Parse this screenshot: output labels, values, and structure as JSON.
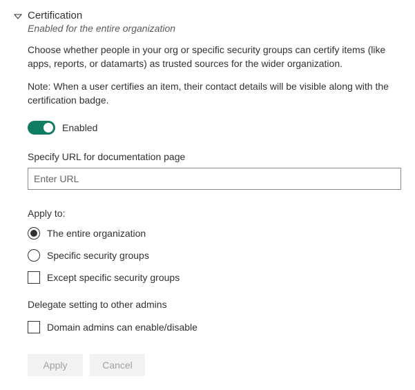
{
  "header": {
    "title": "Certification",
    "subtitle": "Enabled for the entire organization"
  },
  "description": "Choose whether people in your org or specific security groups can certify items (like apps, reports, or datamarts) as trusted sources for the wider organization.",
  "note": "Note: When a user certifies an item, their contact details will be visible along with the certification badge.",
  "toggle": {
    "label": "Enabled"
  },
  "url_field": {
    "label": "Specify URL for documentation page",
    "placeholder": "Enter URL",
    "value": ""
  },
  "apply_to": {
    "label": "Apply to:",
    "options": {
      "entire_org": "The entire organization",
      "specific_groups": "Specific security groups"
    },
    "except_label": "Except specific security groups"
  },
  "delegate": {
    "label": "Delegate setting to other admins",
    "domain_admins_label": "Domain admins can enable/disable"
  },
  "buttons": {
    "apply": "Apply",
    "cancel": "Cancel"
  }
}
